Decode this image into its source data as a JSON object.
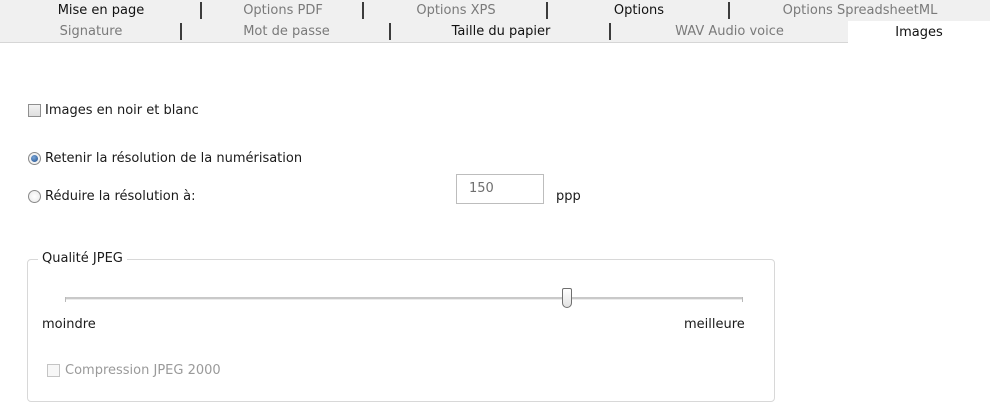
{
  "tabs_row1": [
    {
      "label": "Mise en page",
      "emphasis": "dark"
    },
    {
      "label": "Options PDF",
      "emphasis": "muted"
    },
    {
      "label": "Options XPS",
      "emphasis": "muted"
    },
    {
      "label": "Options",
      "emphasis": "dark"
    },
    {
      "label": "Options SpreadsheetML",
      "emphasis": "muted"
    }
  ],
  "tabs_row2": [
    {
      "label": "Signature",
      "emphasis": "muted"
    },
    {
      "label": "Mot de passe",
      "emphasis": "muted"
    },
    {
      "label": "Taille du papier",
      "emphasis": "dark"
    },
    {
      "label": "WAV Audio voice",
      "emphasis": "muted"
    },
    {
      "label": "Images",
      "emphasis": "active"
    }
  ],
  "images": {
    "bw_checkbox": {
      "label": "Images en noir et blanc",
      "checked": false
    },
    "resolution": {
      "keep_label": "Retenir la résolution de la numérisation",
      "reduce_label": "Réduire la résolution à:",
      "selected": "keep",
      "value": "150",
      "unit": "ppp"
    },
    "jpeg": {
      "title": "Qualité JPEG",
      "min_label": "moindre",
      "max_label": "meilleure",
      "quality_fraction": 0.74,
      "jpeg2000_label": "Compression JPEG 2000",
      "jpeg2000_checked": false,
      "jpeg2000_enabled": false
    }
  },
  "colors": {
    "tab_background": "#f0f0f0",
    "active_tab_background": "#ffffff",
    "radio_selected": "#1f4e8c"
  }
}
